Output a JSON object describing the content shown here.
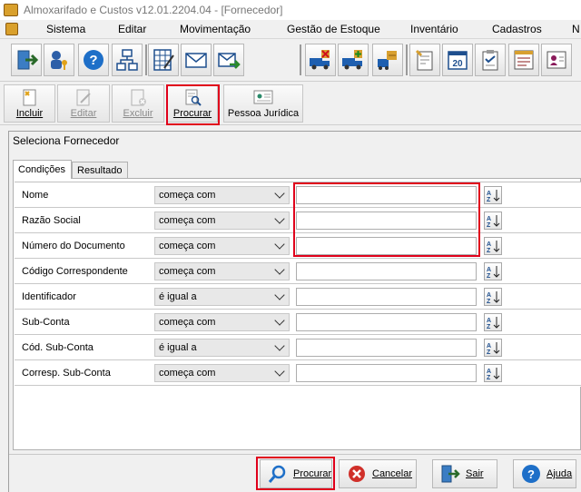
{
  "window": {
    "title": "Almoxarifado e Custos v12.01.2204.04 - [Fornecedor]"
  },
  "menu": {
    "items": [
      "Sistema",
      "Editar",
      "Movimentação",
      "Gestão de Estoque",
      "Inventário",
      "Cadastros",
      "N"
    ]
  },
  "toolbar": {
    "icons": [
      "exit-door-icon",
      "users-key-icon",
      "help-icon",
      "org-chart-icon",
      "calculator-grid-icon",
      "mail-icon",
      "mail-send-icon",
      "truck-remove-icon",
      "truck-add-icon",
      "transfer-icon",
      "certificate-icon",
      "calendar-20-icon",
      "clipboard-check-icon",
      "list-form-icon",
      "contact-card-icon"
    ]
  },
  "actions": {
    "incluir": "Incluir",
    "editar": "Editar",
    "excluir": "Excluir",
    "procurar": "Procurar",
    "pessoa_juridica": "Pessoa Jurídica"
  },
  "form": {
    "title": "Seleciona Fornecedor",
    "tabs": {
      "conditions": "Condições",
      "result": "Resultado"
    },
    "rows": [
      {
        "label": "Nome",
        "operator": "começa com",
        "value": ""
      },
      {
        "label": "Razão Social",
        "operator": "começa com",
        "value": ""
      },
      {
        "label": "Número do Documento",
        "operator": "começa com",
        "value": ""
      },
      {
        "label": "Código Correspondente",
        "operator": "começa com",
        "value": ""
      },
      {
        "label": "Identificador",
        "operator": "é igual a",
        "value": ""
      },
      {
        "label": "Sub-Conta",
        "operator": "começa com",
        "value": ""
      },
      {
        "label": "Cód. Sub-Conta",
        "operator": "é igual a",
        "value": ""
      },
      {
        "label": "Corresp. Sub-Conta",
        "operator": "começa com",
        "value": ""
      }
    ]
  },
  "buttons": {
    "procurar": "Procurar",
    "cancelar": "Cancelar",
    "sair": "Sair",
    "ajuda": "Ajuda"
  },
  "colors": {
    "highlight": "#e0001b",
    "accent_blue": "#1e6fc8"
  }
}
